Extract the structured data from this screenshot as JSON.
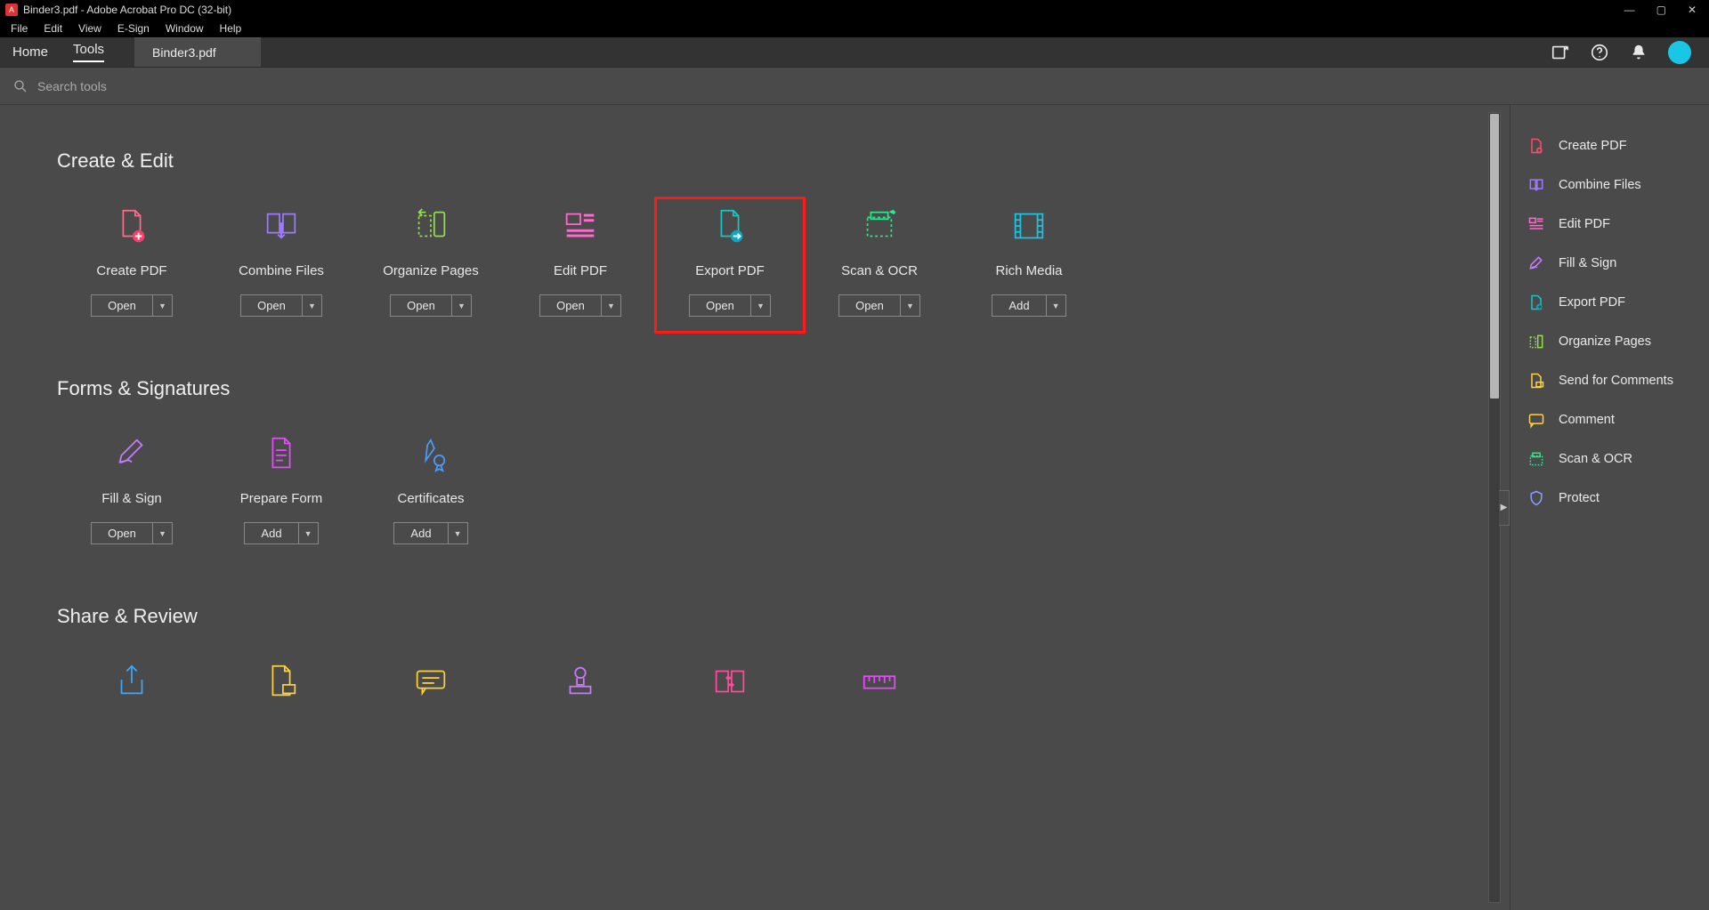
{
  "window": {
    "title": "Binder3.pdf - Adobe Acrobat Pro DC (32-bit)"
  },
  "menu": [
    "File",
    "Edit",
    "View",
    "E-Sign",
    "Window",
    "Help"
  ],
  "nav_tabs": {
    "home": "Home",
    "tools": "Tools"
  },
  "doc_tab": "Binder3.pdf",
  "search": {
    "placeholder": "Search tools"
  },
  "buttons": {
    "open": "Open",
    "add": "Add"
  },
  "sections": {
    "create_edit": {
      "title": "Create & Edit",
      "tools": [
        {
          "label": "Create PDF",
          "btn": "open"
        },
        {
          "label": "Combine Files",
          "btn": "open"
        },
        {
          "label": "Organize Pages",
          "btn": "open"
        },
        {
          "label": "Edit PDF",
          "btn": "open"
        },
        {
          "label": "Export PDF",
          "btn": "open",
          "highlight": true
        },
        {
          "label": "Scan & OCR",
          "btn": "open"
        },
        {
          "label": "Rich Media",
          "btn": "add"
        }
      ]
    },
    "forms": {
      "title": "Forms & Signatures",
      "tools": [
        {
          "label": "Fill & Sign",
          "btn": "open"
        },
        {
          "label": "Prepare Form",
          "btn": "add"
        },
        {
          "label": "Certificates",
          "btn": "add"
        }
      ]
    },
    "share": {
      "title": "Share & Review"
    }
  },
  "right_panel": [
    "Create PDF",
    "Combine Files",
    "Edit PDF",
    "Fill & Sign",
    "Export PDF",
    "Organize Pages",
    "Send for Comments",
    "Comment",
    "Scan & OCR",
    "Protect"
  ]
}
